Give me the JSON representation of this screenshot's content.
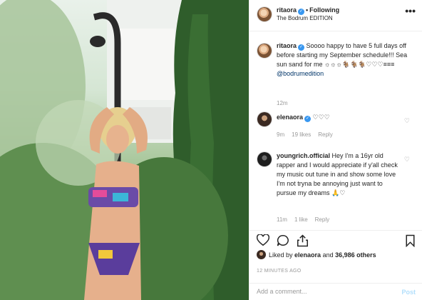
{
  "header": {
    "username": "ritaora",
    "follow_label": "Following",
    "location": "The Bodrum EDITION",
    "more_glyph": "•••"
  },
  "caption": {
    "username": "ritaora",
    "text": "Soooo happy to have 5 full days off before starting my September schedule!!! Sea sun sand for me ☼☼☼🐐🐐🐐♡♡♡≡≡≡",
    "mention": "@bodrumedition",
    "time": "12m"
  },
  "comments": [
    {
      "username": "elenaora",
      "text": "♡♡♡",
      "time": "9m",
      "likes": "19 likes",
      "reply": "Reply"
    },
    {
      "username": "youngrich.official",
      "text": "Hey I'm a 16yr old rapper and I would appreciate if y'all check my music out tune in and show some love I'm not tryna be annoying just want to pursue my dreams 🙏♡",
      "time": "11m",
      "likes": "1 like",
      "reply": "Reply"
    }
  ],
  "likes_line": {
    "prefix": "Liked by",
    "user": "elenaora",
    "middle": "and",
    "count": "36,986 others"
  },
  "timestamp": "12 MINUTES AGO",
  "add_comment": {
    "placeholder": "Add a comment...",
    "post_label": "Post"
  },
  "colors": {
    "verified": "#3897f0",
    "post_button": "#b2dffc",
    "meta_text": "#999999"
  },
  "icons": [
    "heart-icon",
    "comment-icon",
    "share-icon",
    "bookmark-icon",
    "more-icon",
    "verified-icon"
  ]
}
